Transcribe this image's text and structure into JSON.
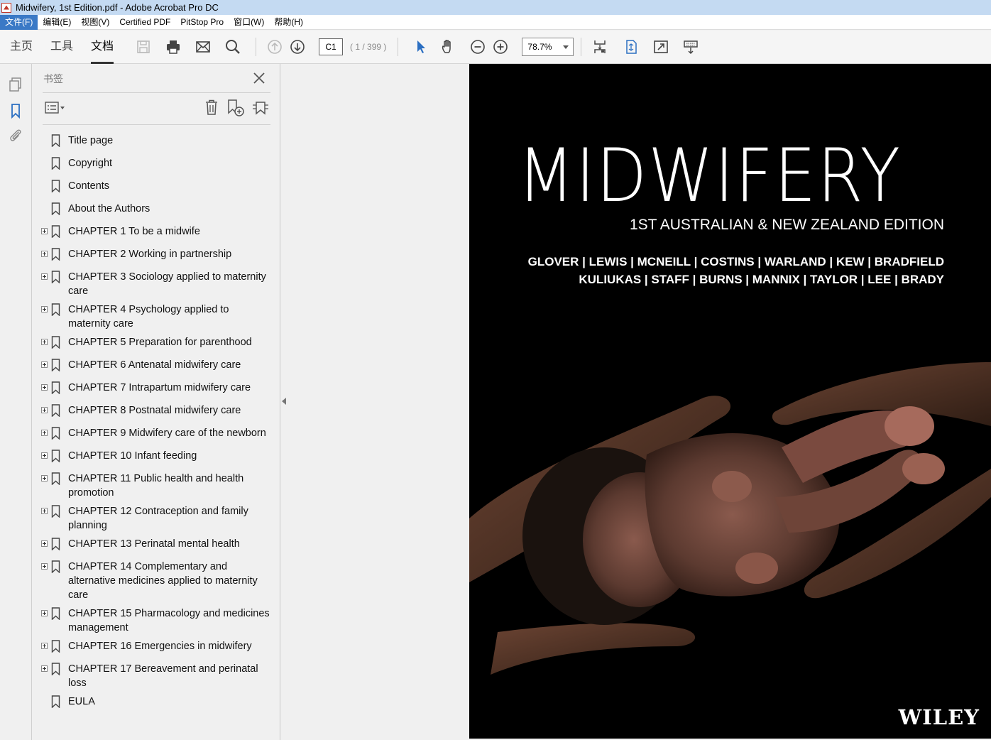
{
  "window": {
    "title": "Midwifery, 1st Edition.pdf - Adobe Acrobat Pro DC"
  },
  "menubar": {
    "items": [
      "文件(F)",
      "编辑(E)",
      "视图(V)",
      "Certified PDF",
      "PitStop Pro",
      "窗口(W)",
      "帮助(H)"
    ]
  },
  "toolbar": {
    "tabs": [
      "主页",
      "工具",
      "文档"
    ],
    "page_input": "C1",
    "page_count": "( 1 / 399 )",
    "zoom": "78.7%"
  },
  "bookmarks_panel": {
    "title": "书签",
    "items": [
      {
        "label": "Title page",
        "expandable": false
      },
      {
        "label": "Copyright",
        "expandable": false
      },
      {
        "label": "Contents",
        "expandable": false
      },
      {
        "label": "About the Authors",
        "expandable": false
      },
      {
        "label": "CHAPTER 1 To be a midwife",
        "expandable": true
      },
      {
        "label": "CHAPTER 2 Working in partnership",
        "expandable": true
      },
      {
        "label": "CHAPTER 3 Sociology applied to maternity care",
        "expandable": true
      },
      {
        "label": "CHAPTER 4 Psychology applied to maternity care",
        "expandable": true
      },
      {
        "label": "CHAPTER 5 Preparation for parenthood",
        "expandable": true
      },
      {
        "label": "CHAPTER 6 Antenatal midwifery care",
        "expandable": true
      },
      {
        "label": "CHAPTER 7 Intrapartum midwifery care",
        "expandable": true
      },
      {
        "label": "CHAPTER 8 Postnatal midwifery care",
        "expandable": true
      },
      {
        "label": "CHAPTER 9 Midwifery care of the newborn",
        "expandable": true
      },
      {
        "label": "CHAPTER 10 Infant feeding",
        "expandable": true
      },
      {
        "label": "CHAPTER 11 Public health and health promotion",
        "expandable": true
      },
      {
        "label": "CHAPTER 12 Contraception and family planning",
        "expandable": true
      },
      {
        "label": "CHAPTER 13 Perinatal mental health",
        "expandable": true
      },
      {
        "label": "CHAPTER 14 Complementary and alternative medicines applied to maternity care",
        "expandable": true
      },
      {
        "label": "CHAPTER 15 Pharmacology and medicines management",
        "expandable": true
      },
      {
        "label": "CHAPTER 16 Emergencies in midwifery",
        "expandable": true
      },
      {
        "label": "CHAPTER 17 Bereavement and perinatal loss",
        "expandable": true
      },
      {
        "label": "EULA",
        "expandable": false
      }
    ]
  },
  "cover": {
    "title": "MIDWIFERY",
    "edition": "1ST AUSTRALIAN & NEW ZEALAND EDITION",
    "authors_line1": "GLOVER | LEWIS | MCNEILL | COSTINS | WARLAND | KEW | BRADFIELD",
    "authors_line2": "KULIUKAS | STAFF | BURNS | MANNIX | TAYLOR | LEE | BRADY",
    "publisher": "WILEY"
  },
  "colors": {
    "accent": "#3a79c6",
    "titlebar": "#c4daf2",
    "cover_bg": "#000000"
  }
}
